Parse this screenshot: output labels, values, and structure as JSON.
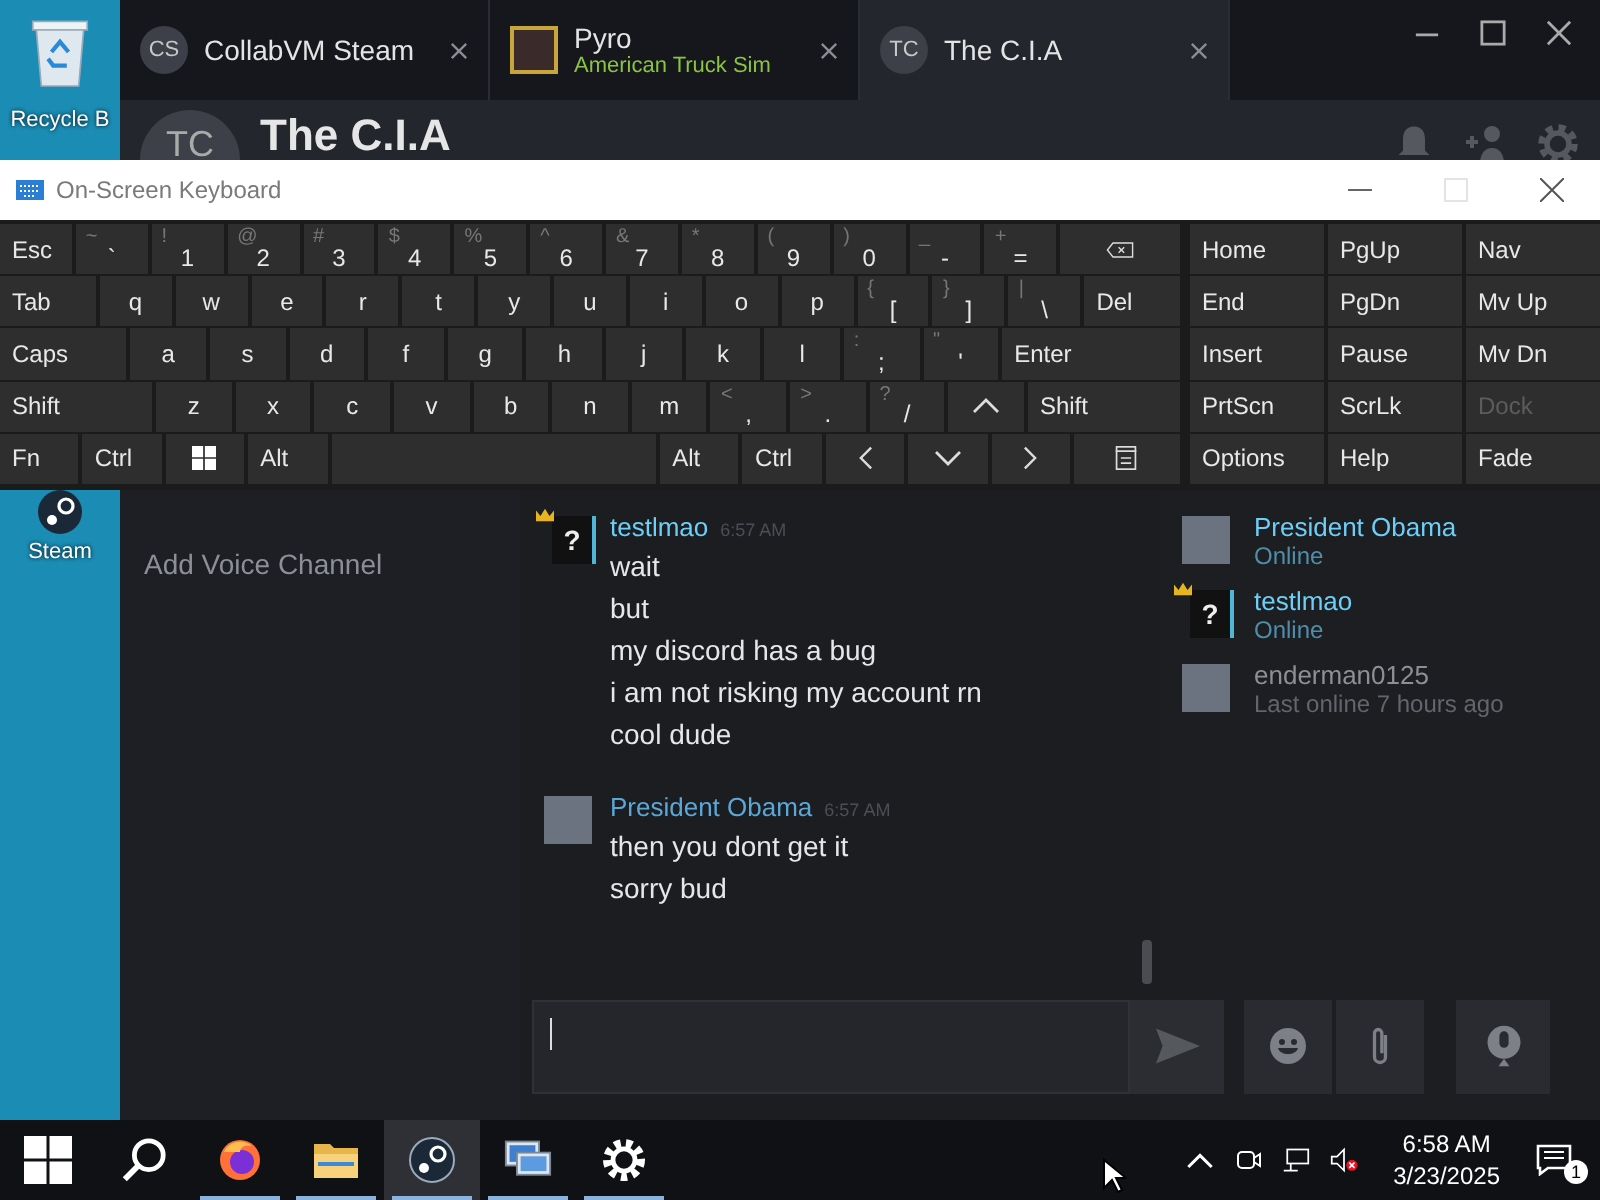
{
  "desktop": {
    "icons": [
      {
        "label": "Recycle B",
        "kind": "recycle"
      },
      {
        "label": "Steam",
        "kind": "steam"
      }
    ]
  },
  "steam": {
    "tabs": [
      {
        "avatar": "CS",
        "title": "CollabVM Steam",
        "selected": false
      },
      {
        "title": "Pyro",
        "subtitle": "American Truck Sim",
        "selected": false
      },
      {
        "avatar": "TC",
        "title": "The C.I.A",
        "selected": true
      }
    ],
    "group": {
      "avatar": "TC",
      "name": "The C.I.A"
    },
    "channels": [
      {
        "label": "Add Voice Channel"
      }
    ],
    "messages": [
      {
        "author": "testlmao",
        "time": "6:57 AM",
        "crown": true,
        "avatar": {
          "kind": "unknown",
          "text": "?"
        },
        "lines": [
          "wait",
          "but",
          "my discord has a bug",
          "i am not risking my account rn",
          "cool dude"
        ]
      },
      {
        "author": "President Obama",
        "time": "6:57 AM",
        "crown": false,
        "avatar": {
          "kind": "photo"
        },
        "lines": [
          "then you dont get it",
          "sorry bud"
        ]
      }
    ],
    "members": [
      {
        "name": "President Obama",
        "status": "Online",
        "online": true,
        "crown": false,
        "avatar": {
          "kind": "photo"
        }
      },
      {
        "name": "testlmao",
        "status": "Online",
        "online": true,
        "crown": true,
        "avatar": {
          "kind": "unknown",
          "text": "?"
        }
      },
      {
        "name": "enderman0125",
        "status": "Last online 7 hours ago",
        "online": false,
        "crown": false,
        "avatar": {
          "kind": "photo"
        }
      }
    ]
  },
  "keyboard": {
    "title": "On-Screen Keyboard",
    "rows": [
      [
        {
          "kind": "text",
          "label": "Esc"
        },
        {
          "kind": "char",
          "shift": "~",
          "label": "`"
        },
        {
          "kind": "char",
          "shift": "!",
          "label": "1"
        },
        {
          "kind": "char",
          "shift": "@",
          "label": "2"
        },
        {
          "kind": "char",
          "shift": "#",
          "label": "3"
        },
        {
          "kind": "char",
          "shift": "$",
          "label": "4"
        },
        {
          "kind": "char",
          "shift": "%",
          "label": "5"
        },
        {
          "kind": "char",
          "shift": "^",
          "label": "6"
        },
        {
          "kind": "char",
          "shift": "&",
          "label": "7"
        },
        {
          "kind": "char",
          "shift": "*",
          "label": "8"
        },
        {
          "kind": "char",
          "shift": "(",
          "label": "9"
        },
        {
          "kind": "char",
          "shift": ")",
          "label": "0"
        },
        {
          "kind": "char",
          "shift": "_",
          "label": "-"
        },
        {
          "kind": "char",
          "shift": "+",
          "label": "="
        },
        {
          "kind": "backspace"
        }
      ],
      [
        {
          "kind": "text",
          "label": "Tab"
        },
        {
          "kind": "char",
          "label": "q"
        },
        {
          "kind": "char",
          "label": "w"
        },
        {
          "kind": "char",
          "label": "e"
        },
        {
          "kind": "char",
          "label": "r"
        },
        {
          "kind": "char",
          "label": "t"
        },
        {
          "kind": "char",
          "label": "y"
        },
        {
          "kind": "char",
          "label": "u"
        },
        {
          "kind": "char",
          "label": "i"
        },
        {
          "kind": "char",
          "label": "o"
        },
        {
          "kind": "char",
          "label": "p"
        },
        {
          "kind": "char",
          "shift": "{",
          "label": "["
        },
        {
          "kind": "char",
          "shift": "}",
          "label": "]"
        },
        {
          "kind": "char",
          "shift": "|",
          "label": "\\"
        },
        {
          "kind": "text",
          "label": "Del"
        }
      ],
      [
        {
          "kind": "text",
          "label": "Caps"
        },
        {
          "kind": "char",
          "label": "a"
        },
        {
          "kind": "char",
          "label": "s"
        },
        {
          "kind": "char",
          "label": "d"
        },
        {
          "kind": "char",
          "label": "f"
        },
        {
          "kind": "char",
          "label": "g"
        },
        {
          "kind": "char",
          "label": "h"
        },
        {
          "kind": "char",
          "label": "j"
        },
        {
          "kind": "char",
          "label": "k"
        },
        {
          "kind": "char",
          "label": "l"
        },
        {
          "kind": "char",
          "shift": ":",
          "label": ";"
        },
        {
          "kind": "char",
          "shift": "\"",
          "label": "'"
        },
        {
          "kind": "text",
          "label": "Enter"
        }
      ],
      [
        {
          "kind": "text",
          "label": "Shift"
        },
        {
          "kind": "char",
          "label": "z"
        },
        {
          "kind": "char",
          "label": "x"
        },
        {
          "kind": "char",
          "label": "c"
        },
        {
          "kind": "char",
          "label": "v"
        },
        {
          "kind": "char",
          "label": "b"
        },
        {
          "kind": "char",
          "label": "n"
        },
        {
          "kind": "char",
          "label": "m"
        },
        {
          "kind": "char",
          "shift": "<",
          "label": ","
        },
        {
          "kind": "char",
          "shift": ">",
          "label": "."
        },
        {
          "kind": "char",
          "shift": "?",
          "label": "/"
        },
        {
          "kind": "up"
        },
        {
          "kind": "text",
          "label": "Shift"
        }
      ],
      [
        {
          "kind": "text",
          "label": "Fn"
        },
        {
          "kind": "text",
          "label": "Ctrl"
        },
        {
          "kind": "windows"
        },
        {
          "kind": "text",
          "label": "Alt"
        },
        {
          "kind": "space"
        },
        {
          "kind": "text",
          "label": "Alt"
        },
        {
          "kind": "text",
          "label": "Ctrl"
        },
        {
          "kind": "left"
        },
        {
          "kind": "down"
        },
        {
          "kind": "right"
        },
        {
          "kind": "menu"
        }
      ]
    ],
    "nav": [
      [
        {
          "label": "Home",
          "disabled": false
        },
        {
          "label": "PgUp",
          "disabled": false
        },
        {
          "label": "Nav",
          "disabled": false
        }
      ],
      [
        {
          "label": "End",
          "disabled": false
        },
        {
          "label": "PgDn",
          "disabled": false
        },
        {
          "label": "Mv Up",
          "disabled": false
        }
      ],
      [
        {
          "label": "Insert",
          "disabled": false
        },
        {
          "label": "Pause",
          "disabled": false
        },
        {
          "label": "Mv Dn",
          "disabled": false
        }
      ],
      [
        {
          "label": "PrtScn",
          "disabled": false
        },
        {
          "label": "ScrLk",
          "disabled": false
        },
        {
          "label": "Dock",
          "disabled": true
        }
      ],
      [
        {
          "label": "Options",
          "disabled": false
        },
        {
          "label": "Help",
          "disabled": false
        },
        {
          "label": "Fade",
          "disabled": false
        }
      ]
    ]
  },
  "taskbar": {
    "apps": [
      {
        "kind": "firefox",
        "running": true,
        "selected": false
      },
      {
        "kind": "explorer",
        "running": true,
        "selected": false
      },
      {
        "kind": "steam",
        "running": true,
        "selected": true
      },
      {
        "kind": "remote",
        "running": true,
        "selected": false
      },
      {
        "kind": "settings",
        "running": true,
        "selected": false
      }
    ],
    "time": "6:58 AM",
    "date": "3/23/2025",
    "notifications": "1"
  }
}
